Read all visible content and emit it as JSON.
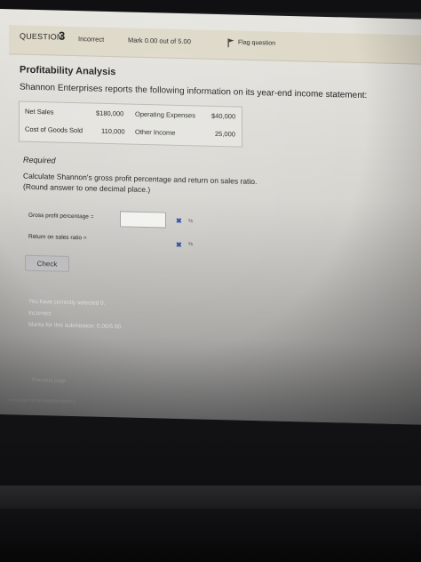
{
  "header": {
    "question_label": "QUESTION",
    "question_number": "3",
    "status": "Incorrect",
    "mark": "Mark 0.00 out of 5.00",
    "flag_label": "Flag question"
  },
  "problem": {
    "title": "Profitability Analysis",
    "intro": "Shannon Enterprises reports the following information on its year-end income statement:",
    "table": [
      {
        "label": "Net Sales",
        "value": "$180,000",
        "label2": "Operating Expenses",
        "value2": "$40,000"
      },
      {
        "label": "Cost of Goods Sold",
        "value": "110,000",
        "label2": "Other Income",
        "value2": "25,000"
      }
    ]
  },
  "required": {
    "heading": "Required",
    "line1": "Calculate Shannon's gross profit percentage and return on sales ratio.",
    "line2": "(Round answer to one decimal place.)"
  },
  "answers": [
    {
      "label": "Gross profit percentage =",
      "value": "",
      "unit": "%"
    },
    {
      "label": "Return on sales ratio =",
      "value": "",
      "unit": "%"
    }
  ],
  "check_label": "Check",
  "feedback": {
    "line1": "You have correctly selected 0.",
    "line2": "Incorrect",
    "line3": "Marks for this submission: 0.00/5.00."
  },
  "nav": {
    "previous": "Previous page"
  },
  "url_fragment": "view.php?id=61668&section=1",
  "colors": {
    "header_bar": "#ddd8c7",
    "cross": "#2a46a8",
    "page": "#e2e1dc"
  }
}
